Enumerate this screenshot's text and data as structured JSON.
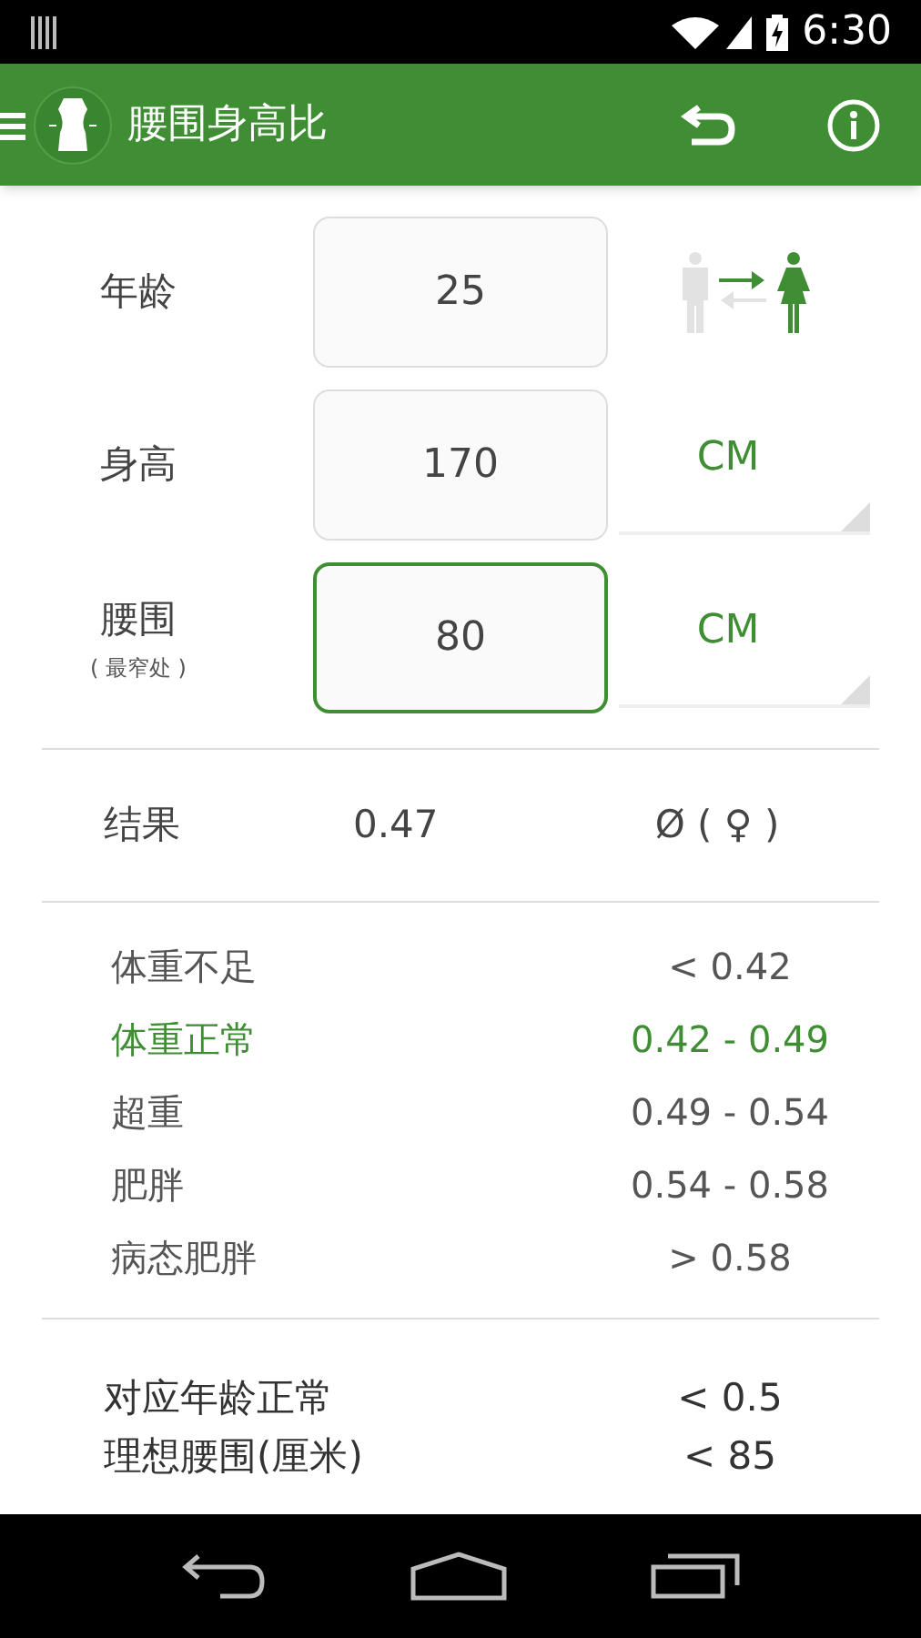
{
  "status_bar": {
    "time": "6:30"
  },
  "app_bar": {
    "title": "腰围身高比"
  },
  "inputs": [
    {
      "kind": "gender",
      "label": "年龄",
      "value": "25",
      "focused": false,
      "female_selected": true
    },
    {
      "kind": "unit",
      "label": "身高",
      "value": "170",
      "focused": false,
      "unit": "CM"
    },
    {
      "kind": "unit",
      "label": "腰围",
      "sublabel": "( 最窄处 )",
      "value": "80",
      "focused": true,
      "unit": "CM"
    }
  ],
  "result": {
    "label": "结果",
    "value": "0.47",
    "gender": "Ø ( ♀ )"
  },
  "categories": [
    {
      "label": "体重不足",
      "range": "< 0.42",
      "selected": false
    },
    {
      "label": "体重正常",
      "range": "0.42 - 0.49",
      "selected": true
    },
    {
      "label": "超重",
      "range": "0.49 - 0.54",
      "selected": false
    },
    {
      "label": "肥胖",
      "range": "0.54 - 0.58",
      "selected": false
    },
    {
      "label": "病态肥胖",
      "range": "> 0.58",
      "selected": false
    }
  ],
  "summary": [
    {
      "label": "对应年龄正常",
      "value": "< 0.5"
    },
    {
      "label": "理想腰围(厘米)",
      "value": "< 85"
    }
  ]
}
